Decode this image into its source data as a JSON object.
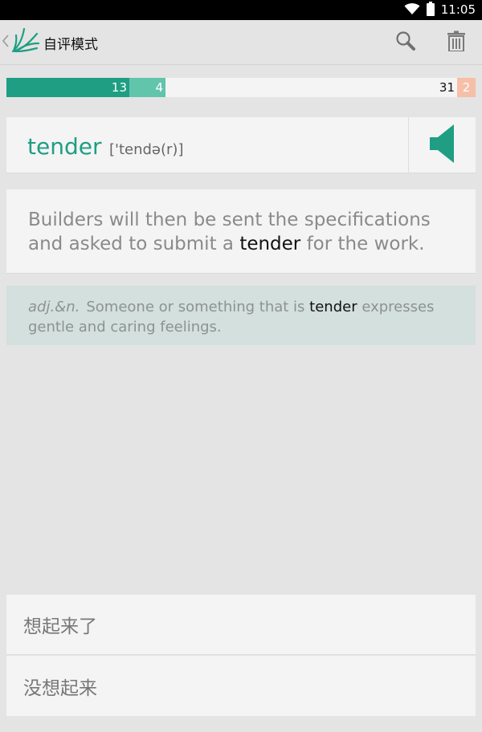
{
  "status_bar": {
    "time": "11:05",
    "icons": [
      "wifi-icon",
      "battery-icon"
    ]
  },
  "app_bar": {
    "title": "自评模式",
    "icons": [
      "back-chevron-icon",
      "app-logo-icon",
      "search-icon",
      "trash-icon"
    ]
  },
  "progress": {
    "known": "13",
    "review": "4",
    "remaining": "31",
    "unknown": "2",
    "colors": {
      "known": "#1f9e84",
      "review": "#61c5ac",
      "unknown": "#f6bfa8"
    }
  },
  "word_card": {
    "word": "tender",
    "phonetic": "['tendə(r)]",
    "sound_icon": "speaker-icon"
  },
  "example": {
    "before": "Builders will then be sent the specifications and asked to submit a ",
    "highlight": "tender",
    "after": " for the work."
  },
  "definition": {
    "pos": "adj.&n.",
    "before": "Someone or something that is ",
    "highlight": "tender",
    "after": " expresses gentle and caring feelings."
  },
  "answers": {
    "remember_label": "想起来了",
    "forgot_label": "没想起来"
  },
  "theme": {
    "accent": "#1f9e84",
    "background": "#e4e4e4",
    "card": "#f4f4f4",
    "definition_bg": "#d3e0dd"
  }
}
